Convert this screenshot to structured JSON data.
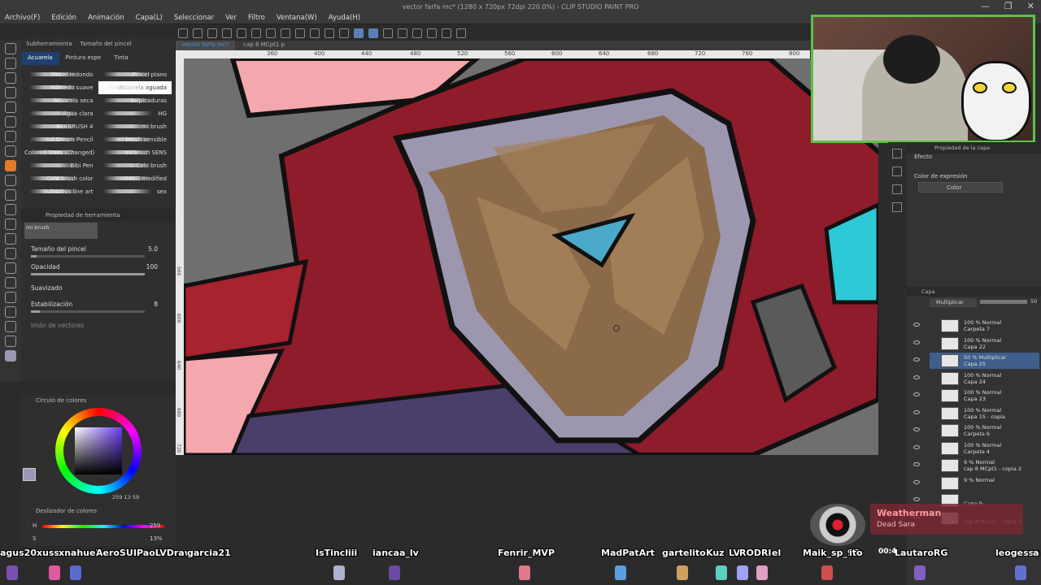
{
  "window": {
    "title": "vector farfa mc* (1280 x 720px 72dpi 220.0%) - CLIP STUDIO PAINT PRO",
    "controls": [
      "—",
      "❐",
      "✕"
    ]
  },
  "menu": [
    "Archivo(F)",
    "Edición",
    "Animación",
    "Capa(L)",
    "Seleccionar",
    "Ver",
    "Filtro",
    "Ventana(W)",
    "Ayuda(H)"
  ],
  "subtool": {
    "tabs": [
      "Subherramienta",
      "Tamaño del pincel"
    ],
    "group_tabs": [
      "Acuarela",
      "Pintura espe",
      "Tinta"
    ],
    "brushes": [
      "Pincel redondo",
      "Pincel plano",
      "Húmedo suave",
      "Acuarela aguada",
      "Acuarela seca",
      "Salpicaduras",
      "Agua clara",
      "HG",
      "REKBRUSH 4",
      "mi brush",
      "Sai Cream Pencil",
      "mi brush sensible",
      "Colored Trees (Changed)",
      "mi brush SENS",
      "Bibi Pen",
      "Colo brush",
      "Colo brush color",
      "HIMOG modified",
      "Subsubus line art",
      "sex"
    ]
  },
  "toolprop": {
    "header": "Propiedad de herramienta",
    "brush_name": "mi brush",
    "size_label": "Tamaño del pincel",
    "size_value": "5.0",
    "size_fill": 0.05,
    "opacity_label": "Opacidad",
    "opacity_value": "100",
    "opacity_fill": 1.0,
    "smooth_label": "Suavizado",
    "stab_label": "Estabilización",
    "stab_value": "8",
    "stab_fill": 0.08,
    "vector_label": "Imán de vectores"
  },
  "colorwheel": {
    "header": "Círculo de colores",
    "readout": "259 13 59",
    "current": "#9a97b8"
  },
  "colorslider": {
    "header": "Deslizador de colores",
    "h_label": "H",
    "h_value": "259",
    "s_label": "S",
    "s_value": "13%"
  },
  "canvas": {
    "tabs": [
      "vector farfa mc*",
      "cap 8 MCpt1 p"
    ],
    "ruler_h": [
      "360",
      "400",
      "440",
      "480",
      "520",
      "560",
      "600",
      "640",
      "680",
      "720",
      "760",
      "800"
    ],
    "ruler_v": [
      "560",
      "600",
      "640",
      "680",
      "720"
    ]
  },
  "layer_property": {
    "header": "Propiedad de la capa",
    "effect_label": "Efecto",
    "expr_label": "Color de expresión",
    "expr_value": "Color"
  },
  "layers": {
    "header": "Capa",
    "blend_mode": "Multiplicar",
    "opacity": "50",
    "items": [
      {
        "mode": "100 % Normal",
        "name": "Carpeta 7"
      },
      {
        "mode": "100 % Normal",
        "name": "Capa 22"
      },
      {
        "mode": "50 % Multiplicar",
        "name": "Capa 25"
      },
      {
        "mode": "100 % Normal",
        "name": "Capa 24"
      },
      {
        "mode": "100 % Normal",
        "name": "Capa 23"
      },
      {
        "mode": "100 % Normal",
        "name": "Capa 15 - copia"
      },
      {
        "mode": "100 % Normal",
        "name": "Carpeta 6"
      },
      {
        "mode": "100 % Normal",
        "name": "Carpeta 4"
      },
      {
        "mode": "9 % Normal",
        "name": "cap 8 MCpt1 - copia 2"
      },
      {
        "mode": "9 % Normal",
        "name": ""
      },
      {
        "mode": "",
        "name": "Capa 9"
      },
      {
        "mode": "",
        "name": "cap 8 MCpt1 - copia 3"
      }
    ]
  },
  "nowplaying": {
    "title": "Weatherman",
    "artist": "Dead Sara",
    "time": "00:4"
  },
  "chat": {
    "names": [
      "agus20xx",
      "uss",
      "xnahuel",
      "Aero",
      "SUI",
      "PaoLVDraw",
      "garcia21",
      "IsTincho",
      "iii",
      "iancaa_lv",
      "Fenrir_MVP",
      "MadPatArt",
      "gartelito",
      "Kuz",
      "LV",
      "RODRI",
      "el",
      "Maik_sp_98",
      "ito",
      "LautaroRG",
      "leogessa",
      "a"
    ]
  },
  "colors": {
    "accent": "#e07a2c",
    "selection": "#3f5e8c",
    "webcam_border": "#5cc245",
    "art_red": "#8e1c2b",
    "art_shield": "#8b6a49",
    "art_rim": "#9c97ae",
    "art_gem": "#4aa9c8"
  }
}
